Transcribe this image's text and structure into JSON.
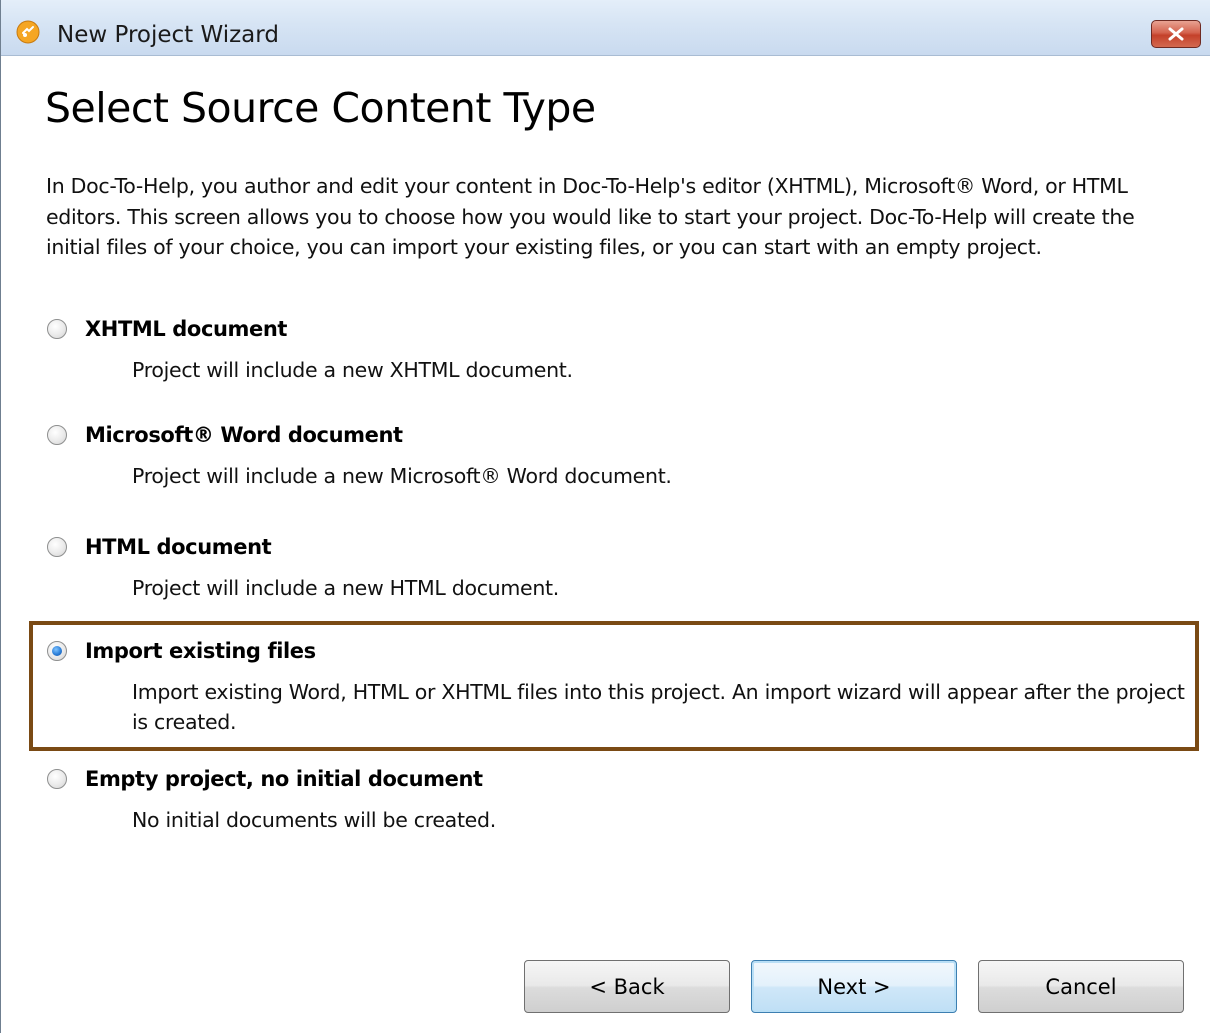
{
  "window": {
    "title": "New Project Wizard",
    "close_glyph": "✕"
  },
  "page": {
    "heading": "Select Source Content Type",
    "intro": "In Doc-To-Help, you author and edit your content in Doc-To-Help's editor (XHTML), Microsoft® Word, or HTML editors. This screen allows you to choose how you would like to start your project. Doc-To-Help will create the initial files of your choice, you can import your existing files, or you can start with an empty project."
  },
  "options": [
    {
      "label": "XHTML document",
      "description": "Project will include a new XHTML document.",
      "selected": false
    },
    {
      "label": "Microsoft® Word document",
      "description": "Project will include a new Microsoft® Word document.",
      "selected": false
    },
    {
      "label": "HTML document",
      "description": "Project will include a new HTML document.",
      "selected": false
    },
    {
      "label": "Import existing files",
      "description": "Import existing Word, HTML or XHTML files into this project. An import wizard will appear after the project is created.",
      "selected": true
    },
    {
      "label": "Empty project, no initial document",
      "description": "No initial documents will be created.",
      "selected": false
    }
  ],
  "buttons": {
    "back": "< Back",
    "next": "Next >",
    "cancel": "Cancel"
  },
  "colors": {
    "highlight_border": "#7a4a14",
    "radio_selected": "#2b7fd9"
  }
}
